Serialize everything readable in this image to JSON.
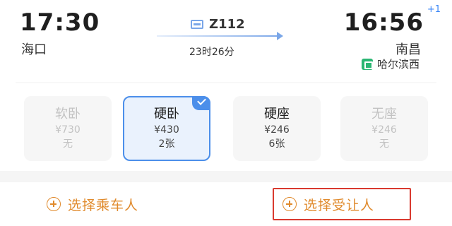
{
  "journey": {
    "departure": {
      "time": "17:30",
      "station": "海口"
    },
    "arrival": {
      "time": "16:56",
      "day_offset": "+1",
      "station": "南昌"
    },
    "train": {
      "code": "Z112",
      "icon": "train-icon"
    },
    "duration": "23时26分",
    "transfer": {
      "icon": "station-badge-icon",
      "label": "哈尔滨西"
    }
  },
  "seats": [
    {
      "name": "软卧",
      "price": "¥730",
      "stock": "无",
      "state": "disabled"
    },
    {
      "name": "硬卧",
      "price": "¥430",
      "stock": "2张",
      "state": "selected"
    },
    {
      "name": "硬座",
      "price": "¥246",
      "stock": "6张",
      "state": "available"
    },
    {
      "name": "无座",
      "price": "¥246",
      "stock": "无",
      "state": "disabled"
    }
  ],
  "actions": {
    "choose_passenger": {
      "label": "选择乘车人",
      "icon": "plus-circle-icon"
    },
    "choose_yield_person": {
      "label": "选择受让人",
      "icon": "plus-circle-icon",
      "highlighted": true
    }
  },
  "colors": {
    "accent_blue": "#4c8fea",
    "action_orange": "#e08a2c",
    "highlight_red": "#d93a2f",
    "transfer_green": "#2bb673"
  }
}
